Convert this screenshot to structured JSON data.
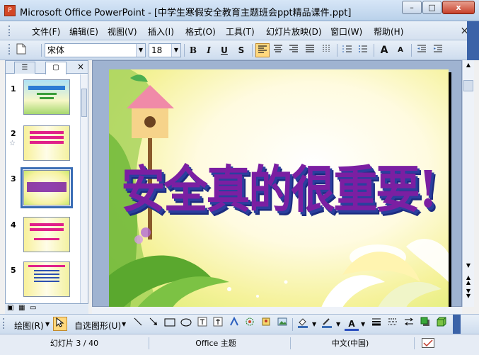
{
  "window": {
    "title": "Microsoft Office PowerPoint - [中学生寒假安全教育主题班会ppt精品课件.ppt]",
    "app_icon_label": "P",
    "min_label": "–",
    "max_label": "□",
    "close_label": "x"
  },
  "menu": {
    "items": [
      "文件(F)",
      "编辑(E)",
      "视图(V)",
      "插入(I)",
      "格式(O)",
      "工具(T)",
      "幻灯片放映(D)",
      "窗口(W)",
      "帮助(H)"
    ],
    "close_label": "×"
  },
  "toolbar": {
    "font_name": "宋体",
    "font_size": "18",
    "bold": "B",
    "italic": "I",
    "underline": "U",
    "shadow": "S",
    "grow_font": "A",
    "shrink_font": "A"
  },
  "slides_panel": {
    "tab_outline": "☰",
    "tab_slides": "▢",
    "close": "×",
    "slide_numbers": [
      "1",
      "2",
      "3",
      "4",
      "5"
    ],
    "selected_index": 3,
    "transition_star": "☆"
  },
  "slide": {
    "heading": "安全真的很重要!"
  },
  "drawing_toolbar": {
    "draw_label": "绘图(R)",
    "autoshapes_label": "自选图形(U)",
    "font_color_label": "A"
  },
  "status": {
    "slide_position": "幻灯片 3 / 40",
    "theme": "Office 主题",
    "language": "中文(中国)"
  },
  "colors": {
    "accent_selected": "#3a6db5",
    "heading_fill": "#7b1fa2",
    "toolbar_active": "#ffd87d"
  }
}
